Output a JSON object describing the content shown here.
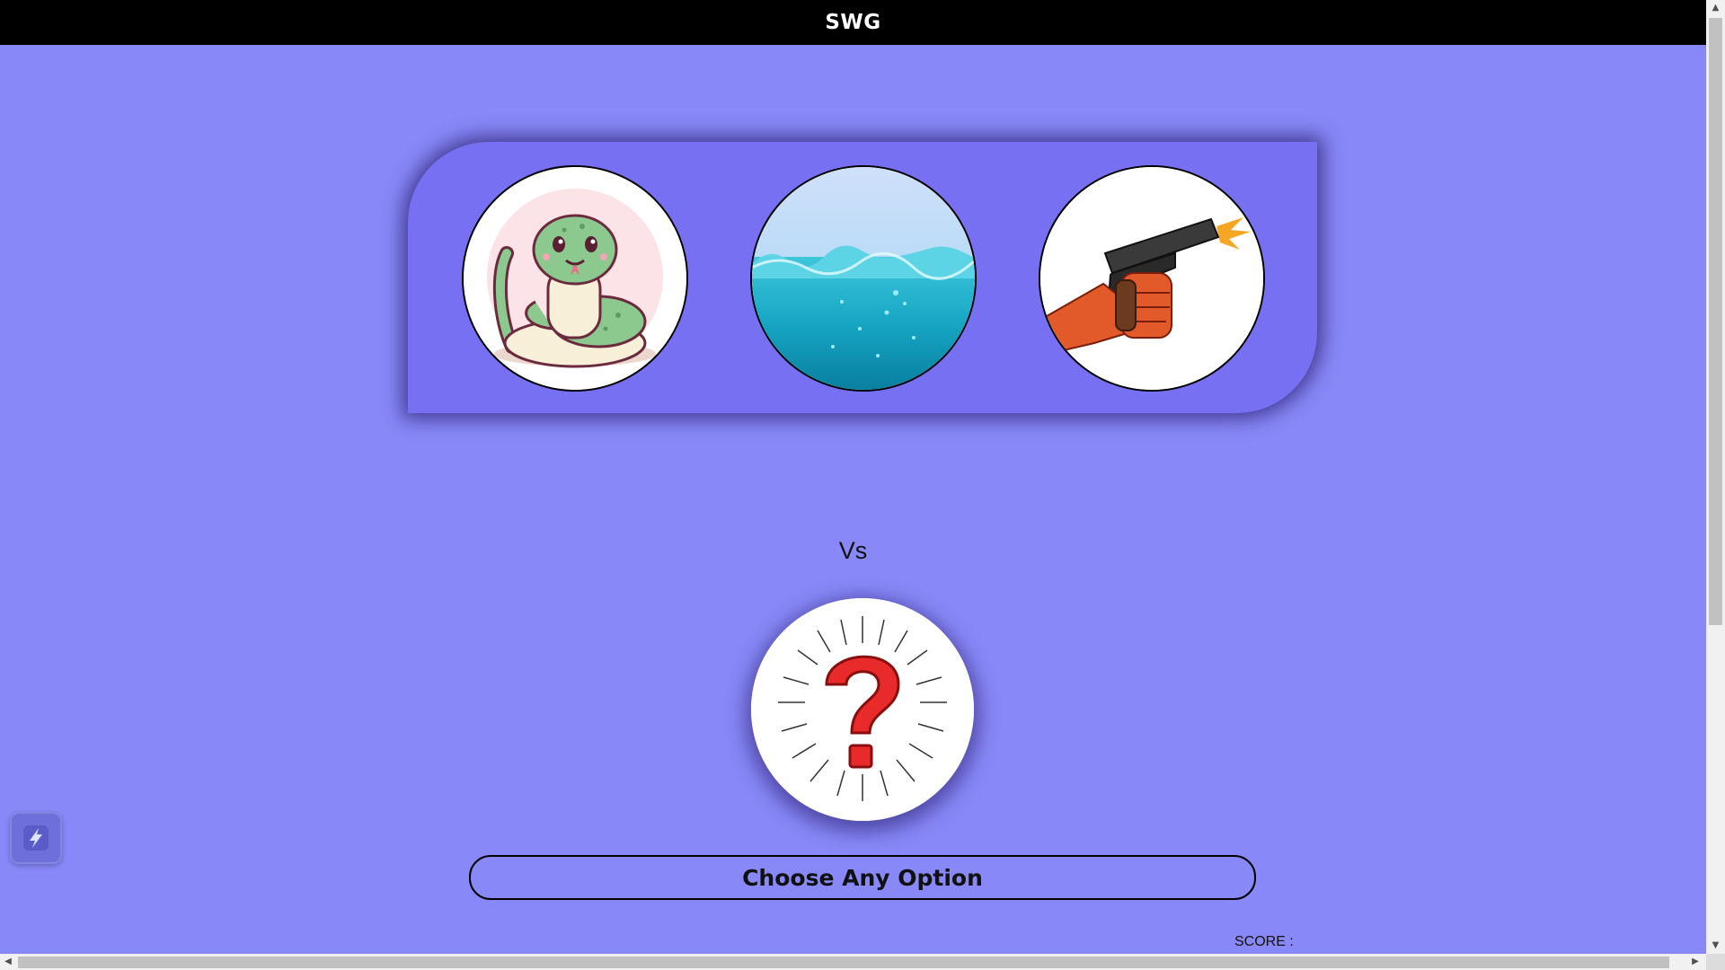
{
  "header": {
    "title": "SWG"
  },
  "options": [
    {
      "name": "snake",
      "icon": "snake-icon"
    },
    {
      "name": "water",
      "icon": "water-icon"
    },
    {
      "name": "gun",
      "icon": "gun-icon"
    }
  ],
  "versus": {
    "label": "Vs"
  },
  "computer_choice": {
    "icon": "question-mark-icon"
  },
  "result": {
    "label": "Choose Any Option"
  },
  "score": {
    "label": "SCORE :",
    "value": ""
  },
  "colors": {
    "background": "#8888f8",
    "panel": "#7870f2",
    "header": "#000000"
  }
}
